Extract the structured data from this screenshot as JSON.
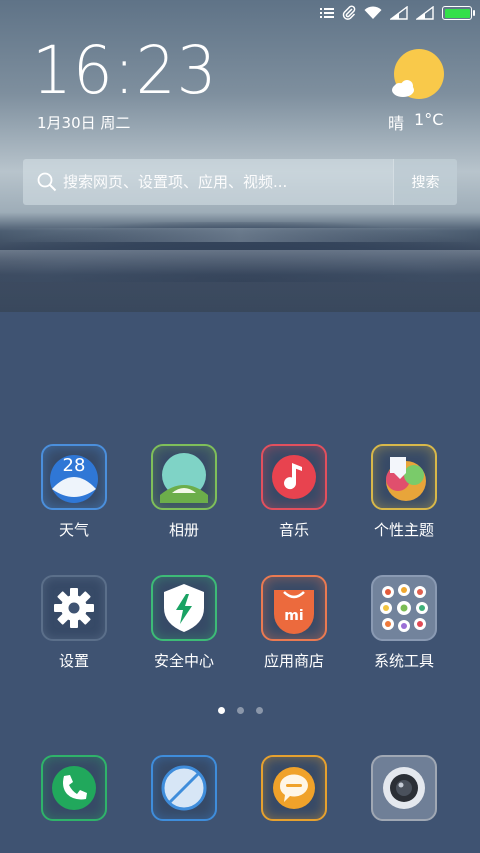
{
  "status_bar": {
    "icons": [
      "list-icon",
      "attachment-icon",
      "wifi-icon",
      "signal-icon",
      "signal-icon",
      "battery-icon"
    ],
    "battery_color": "#33e04a"
  },
  "widget": {
    "time": "16:23",
    "date": "1月30日 周二",
    "weather": {
      "condition": "晴",
      "temperature": "1°C",
      "icon": "sun-cloud-icon"
    }
  },
  "search": {
    "placeholder": "搜索网页、设置项、应用、视频...",
    "button_label": "搜索"
  },
  "apps": [
    {
      "label": "天气",
      "icon": "weather-app-icon",
      "border": "#4b8fdc",
      "badge": "28"
    },
    {
      "label": "相册",
      "icon": "gallery-app-icon",
      "border": "#7fbf5a"
    },
    {
      "label": "音乐",
      "icon": "music-app-icon",
      "border": "#e2505e"
    },
    {
      "label": "个性主题",
      "icon": "themes-app-icon",
      "border": "#d8b84a"
    },
    {
      "label": "设置",
      "icon": "settings-app-icon",
      "border": "#5b6f8a"
    },
    {
      "label": "安全中心",
      "icon": "security-app-icon",
      "border": "#3dbb77"
    },
    {
      "label": "应用商店",
      "icon": "app-store-icon",
      "border": "#ea7a52"
    },
    {
      "label": "系统工具",
      "icon": "system-tools-folder-icon",
      "border": "#8a9ab3"
    }
  ],
  "page_indicator": {
    "pages": 3,
    "current": 1
  },
  "dock": [
    {
      "icon": "phone-app-icon",
      "border": "#2fb36a"
    },
    {
      "icon": "browser-app-icon",
      "border": "#3f8ddb"
    },
    {
      "icon": "messages-app-icon",
      "border": "#e6a12f"
    },
    {
      "icon": "camera-app-icon",
      "border": "#a0a8b4"
    }
  ]
}
